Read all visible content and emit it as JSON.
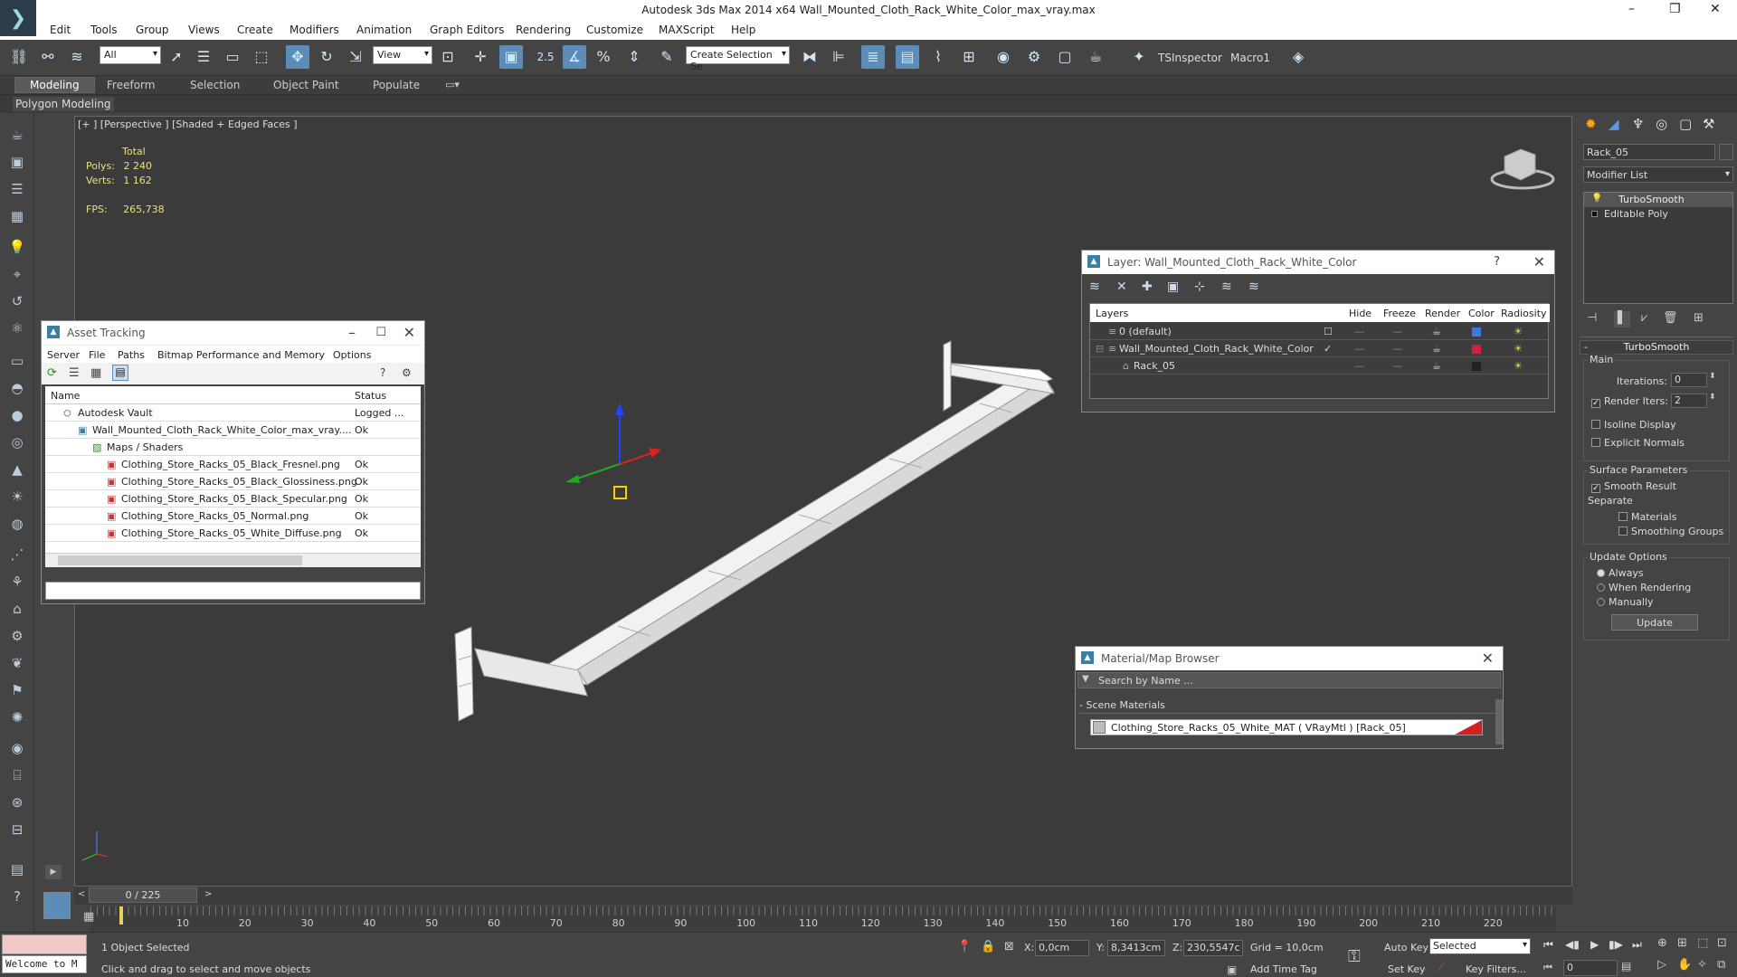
{
  "window": {
    "title": "Autodesk 3ds Max  2014 x64    Wall_Mounted_Cloth_Rack_White_Color_max_vray.max"
  },
  "menu": [
    "Edit",
    "Tools",
    "Group",
    "Views",
    "Create",
    "Modifiers",
    "Animation",
    "Graph Editors",
    "Rendering",
    "Customize",
    "MAXScript",
    "Help"
  ],
  "toolbar": {
    "selection_filter": "All",
    "ref_coord": "View",
    "snap_label": "2.5",
    "named_selection": "Create Selection Se",
    "tsinspector": "TSInspector",
    "macro1": "Macro1"
  },
  "ribbon": {
    "tabs": [
      "Modeling",
      "Freeform",
      "Selection",
      "Object Paint",
      "Populate"
    ],
    "sub": "Polygon Modeling"
  },
  "viewport": {
    "label": "[+ ] [Perspective ] [Shaded + Edged Faces ]",
    "stats_total": "Total",
    "polys_label": "Polys:",
    "polys": "2 240",
    "verts_label": "Verts:",
    "verts": "1 162",
    "fps_label": "FPS:",
    "fps": "265,738"
  },
  "asset_tracking": {
    "title": "Asset Tracking",
    "menu": [
      "Server",
      "File",
      "Paths",
      "Bitmap Performance and Memory",
      "Options"
    ],
    "col_name": "Name",
    "col_status": "Status",
    "rows": [
      {
        "name": "Autodesk Vault",
        "status": "Logged ..."
      },
      {
        "name": "Wall_Mounted_Cloth_Rack_White_Color_max_vray....",
        "status": "Ok"
      },
      {
        "name": "Maps / Shaders",
        "status": ""
      },
      {
        "name": "Clothing_Store_Racks_05_Black_Fresnel.png",
        "status": "Ok"
      },
      {
        "name": "Clothing_Store_Racks_05_Black_Glossiness.png",
        "status": "Ok"
      },
      {
        "name": "Clothing_Store_Racks_05_Black_Specular.png",
        "status": "Ok"
      },
      {
        "name": "Clothing_Store_Racks_05_Normal.png",
        "status": "Ok"
      },
      {
        "name": "Clothing_Store_Racks_05_White_Diffuse.png",
        "status": "Ok"
      }
    ]
  },
  "layers": {
    "title": "Layer: Wall_Mounted_Cloth_Rack_White_Color",
    "question": "?",
    "cols": [
      "Layers",
      "Hide",
      "Freeze",
      "Render",
      "Color",
      "Radiosity"
    ],
    "rows": [
      {
        "name": "0 (default)",
        "color": "#3a7be0"
      },
      {
        "name": "Wall_Mounted_Cloth_Rack_White_Color",
        "color": "#d02040"
      },
      {
        "name": "Rack_05",
        "color": "#222222"
      }
    ]
  },
  "material_browser": {
    "title": "Material/Map Browser",
    "search_placeholder": "Search by Name ...",
    "section": "- Scene Materials",
    "item": "Clothing_Store_Racks_05_White_MAT  ( VRayMtl )  [Rack_05]"
  },
  "command_panel": {
    "object_name": "Rack_05",
    "modifier_list": "Modifier List",
    "stack": [
      "TurboSmooth",
      "Editable Poly"
    ],
    "rollout": "TurboSmooth",
    "main": "Main",
    "iterations_label": "Iterations:",
    "iterations": "0",
    "render_iters_label": "Render Iters:",
    "render_iters": "2",
    "isoline": "Isoline Display",
    "explicit": "Explicit Normals",
    "surface": "Surface Parameters",
    "smooth_result": "Smooth Result",
    "separate": "Separate",
    "materials": "Materials",
    "smoothing_groups": "Smoothing Groups",
    "update_options": "Update Options",
    "always": "Always",
    "when_rendering": "When Rendering",
    "manually": "Manually",
    "update_btn": "Update"
  },
  "timeline": {
    "frame": "0 / 225",
    "ticks": [
      "10",
      "20",
      "30",
      "40",
      "50",
      "60",
      "70",
      "80",
      "90",
      "100",
      "110",
      "120",
      "130",
      "140",
      "150",
      "160",
      "170",
      "180",
      "190",
      "200",
      "210",
      "220"
    ]
  },
  "status": {
    "listener": "Welcome to M",
    "selected": "1 Object Selected",
    "prompt": "Click and drag to select and move objects",
    "x_label": "X:",
    "x": "0,0cm",
    "y_label": "Y:",
    "y": "8,3413cm",
    "z_label": "Z:",
    "z": "230,5547c",
    "grid": "Grid = 10,0cm",
    "add_time_tag": "Add Time Tag",
    "auto_key": "Auto Key",
    "set_key": "Set Key",
    "key_filters": "Key Filters...",
    "key_mode": "Selected",
    "frame_field": "0"
  }
}
